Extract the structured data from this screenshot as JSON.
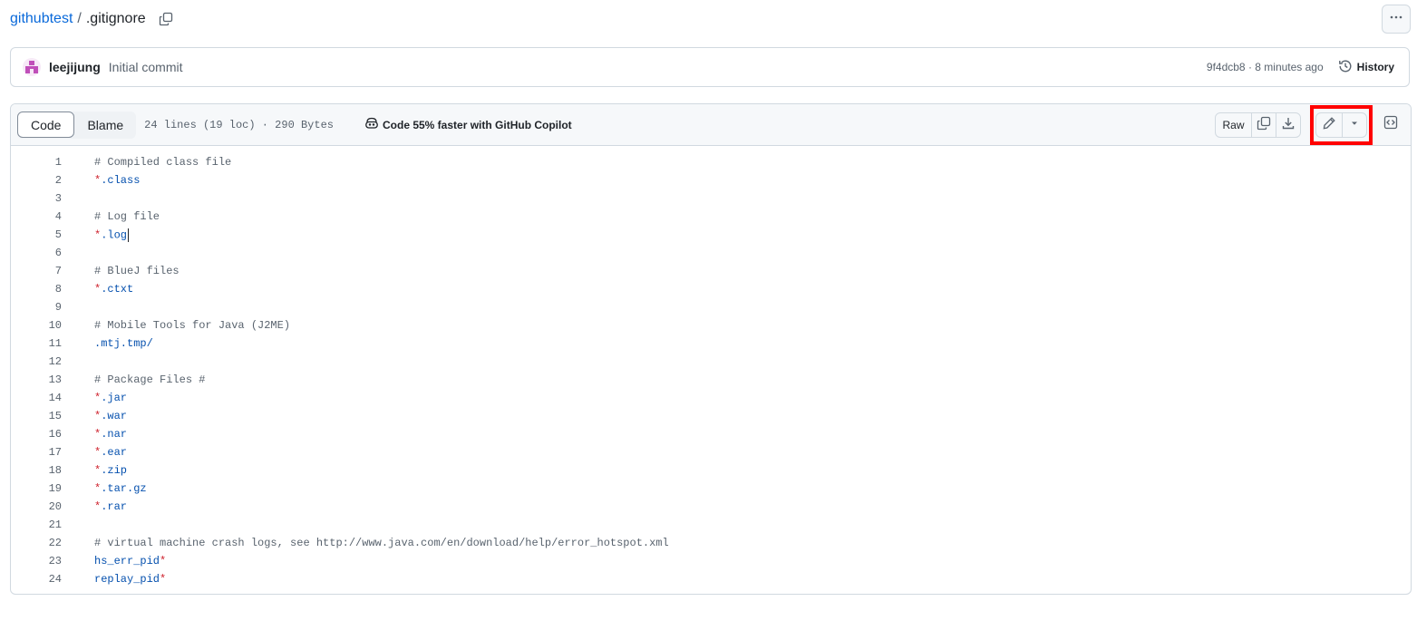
{
  "breadcrumb": {
    "repo": "githubtest",
    "separator": "/",
    "file": ".gitignore"
  },
  "commit": {
    "author": "leejijung",
    "message": "Initial commit",
    "meta": "9f4dcb8 · 8 minutes ago",
    "history_label": "History"
  },
  "file_header": {
    "tab_code": "Code",
    "tab_blame": "Blame",
    "info": "24 lines (19 loc) · 290 Bytes",
    "copilot": "Code 55% faster with GitHub Copilot",
    "raw_label": "Raw"
  },
  "colors": {
    "link": "#0969da",
    "highlight": "#ff0000",
    "comment": "#59636e",
    "pattern": "#0550ae",
    "star": "#cf222e"
  },
  "icons": [
    "copy-icon",
    "kebab-icon",
    "history-icon",
    "copilot-icon",
    "download-icon",
    "pencil-icon",
    "triangle-down-icon",
    "code-square-icon"
  ],
  "lines": [
    {
      "n": "1",
      "pre": "",
      "text": "# Compiled class file",
      "kind": "comment"
    },
    {
      "n": "2",
      "pre": "*",
      "text": ".class",
      "kind": "pattern"
    },
    {
      "n": "3",
      "pre": "",
      "text": "",
      "kind": "blank"
    },
    {
      "n": "4",
      "pre": "",
      "text": "# Log file",
      "kind": "comment"
    },
    {
      "n": "5",
      "pre": "*",
      "text": ".log",
      "kind": "pattern",
      "caret": true
    },
    {
      "n": "6",
      "pre": "",
      "text": "",
      "kind": "blank"
    },
    {
      "n": "7",
      "pre": "",
      "text": "# BlueJ files",
      "kind": "comment"
    },
    {
      "n": "8",
      "pre": "*",
      "text": ".ctxt",
      "kind": "pattern"
    },
    {
      "n": "9",
      "pre": "",
      "text": "",
      "kind": "blank"
    },
    {
      "n": "10",
      "pre": "",
      "text": "# Mobile Tools for Java (J2ME)",
      "kind": "comment"
    },
    {
      "n": "11",
      "pre": "",
      "text": ".mtj.tmp/",
      "kind": "pattern"
    },
    {
      "n": "12",
      "pre": "",
      "text": "",
      "kind": "blank"
    },
    {
      "n": "13",
      "pre": "",
      "text": "# Package Files #",
      "kind": "comment"
    },
    {
      "n": "14",
      "pre": "*",
      "text": ".jar",
      "kind": "pattern"
    },
    {
      "n": "15",
      "pre": "*",
      "text": ".war",
      "kind": "pattern"
    },
    {
      "n": "16",
      "pre": "*",
      "text": ".nar",
      "kind": "pattern"
    },
    {
      "n": "17",
      "pre": "*",
      "text": ".ear",
      "kind": "pattern"
    },
    {
      "n": "18",
      "pre": "*",
      "text": ".zip",
      "kind": "pattern"
    },
    {
      "n": "19",
      "pre": "*",
      "text": ".tar.gz",
      "kind": "pattern"
    },
    {
      "n": "20",
      "pre": "*",
      "text": ".rar",
      "kind": "pattern"
    },
    {
      "n": "21",
      "pre": "",
      "text": "",
      "kind": "blank"
    },
    {
      "n": "22",
      "pre": "",
      "text": "# virtual machine crash logs, see http://www.java.com/en/download/help/error_hotspot.xml",
      "kind": "comment"
    },
    {
      "n": "23",
      "pre": "",
      "text": "hs_err_pid",
      "post": "*",
      "kind": "pattern"
    },
    {
      "n": "24",
      "pre": "",
      "text": "replay_pid",
      "post": "*",
      "kind": "pattern"
    }
  ]
}
